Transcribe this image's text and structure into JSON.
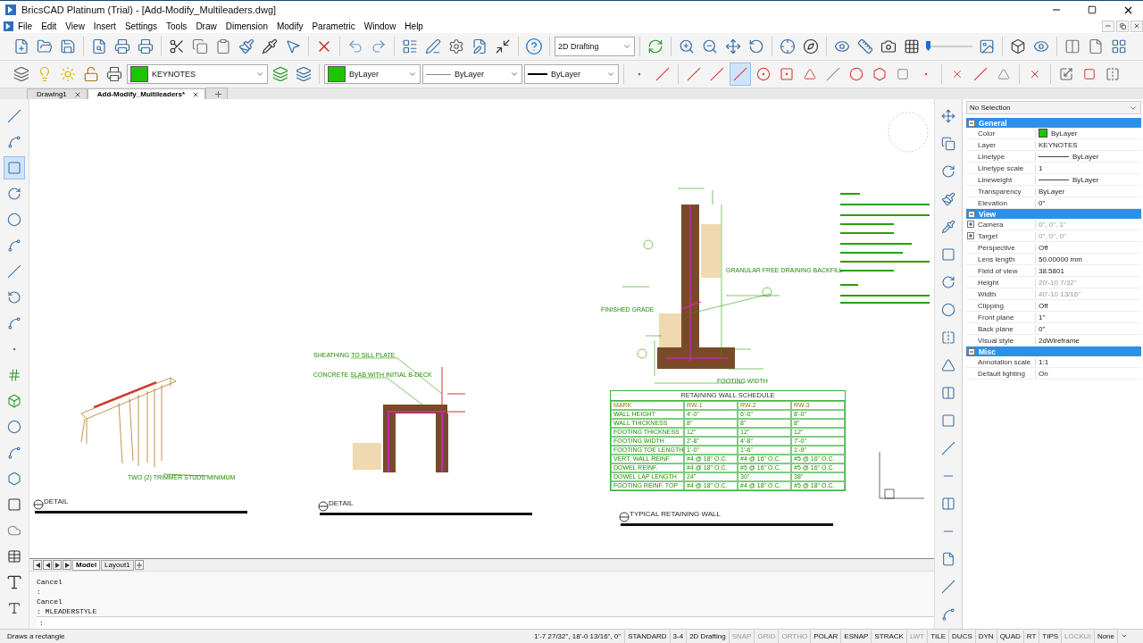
{
  "window": {
    "title": "BricsCAD Platinum (Trial) - [Add-Modify_Multileaders.dwg]"
  },
  "menu": [
    "File",
    "Edit",
    "View",
    "Insert",
    "Settings",
    "Tools",
    "Draw",
    "Dimension",
    "Modify",
    "Parametric",
    "Window",
    "Help"
  ],
  "workspace": {
    "value": "2D Drafting"
  },
  "layer_bar": {
    "layer": "KEYNOTES",
    "entity_color": "ByLayer",
    "linetype": "ByLayer",
    "lineweight": "ByLayer"
  },
  "document_tabs": [
    {
      "label": "Drawing1",
      "selected": false
    },
    {
      "label": "Add-Modify_Multileaders*",
      "selected": true
    }
  ],
  "drawing": {
    "details": [
      {
        "title": "DETAIL"
      },
      {
        "title": "DETAIL"
      },
      {
        "title": "TYPICAL RETAINING WALL"
      }
    ],
    "callouts": [
      {
        "text": "TWO (2) TRIMMER STUDS MINIMUM"
      },
      {
        "text": "SHEATHING TO SILL PLATE"
      },
      {
        "text": "CONCRETE SLAB WITH INITIAL B-DECK"
      },
      {
        "text": "GRANULAR FREE DRAINING BACKFILL"
      },
      {
        "text": "FINISHED GRADE"
      },
      {
        "text": "FOOTING WIDTH"
      }
    ],
    "schedule": {
      "title": "RETAINING WALL SCHEDULE",
      "columns": [
        "MARK",
        "RW-1",
        "RW-2",
        "RW-3"
      ],
      "rows": [
        [
          "WALL HEIGHT",
          "4'-0\"",
          "6'-0\"",
          "8'-0\""
        ],
        [
          "WALL THICKNESS",
          "8\"",
          "8\"",
          "8\""
        ],
        [
          "FOOTING THICKNESS",
          "12\"",
          "12\"",
          "12\""
        ],
        [
          "FOOTING WIDTH",
          "2'-8\"",
          "4'-8\"",
          "7'-0\""
        ],
        [
          "FOOTING TOE LENGTH",
          "1'-0\"",
          "1'-6\"",
          "1'-9\""
        ],
        [
          "VERT. WALL REINF.",
          "#4 @ 18\" O.C.",
          "#4 @ 16\" O.C.",
          "#5 @ 16\" O.C."
        ],
        [
          "DOWEL REINF.",
          "#4 @ 18\" O.C.",
          "#5 @ 16\" O.C.",
          "#5 @ 16\" O.C."
        ],
        [
          "DOWEL LAP LENGTH",
          "24\"",
          "30\"",
          "38\""
        ],
        [
          "FOOTING REINF. TOP",
          "#4 @ 18\" O.C.",
          "#4 @ 18\" O.C.",
          "#5 @ 18\" O.C."
        ]
      ]
    }
  },
  "properties": {
    "selection": "No Selection",
    "sections": [
      {
        "title": "General",
        "expanded": true,
        "rows": [
          {
            "label": "Color",
            "value": "ByLayer",
            "kind": "color"
          },
          {
            "label": "Layer",
            "value": "KEYNOTES",
            "kind": "text"
          },
          {
            "label": "Linetype",
            "value": "ByLayer",
            "kind": "line"
          },
          {
            "label": "Linetype scale",
            "value": "1",
            "kind": "text"
          },
          {
            "label": "Lineweight",
            "value": "ByLayer",
            "kind": "line"
          },
          {
            "label": "Transparency",
            "value": "ByLayer",
            "kind": "text"
          },
          {
            "label": "Elevation",
            "value": "0\"",
            "kind": "text"
          }
        ]
      },
      {
        "title": "View",
        "expanded": true,
        "rows": [
          {
            "label": "Camera",
            "value": "0\", 0\", 1\"",
            "kind": "group",
            "expanded": false,
            "disabled": true
          },
          {
            "label": "Target",
            "value": "0\", 0\", 0\"",
            "kind": "group",
            "expanded": false,
            "disabled": true
          },
          {
            "label": "Perspective",
            "value": "Off",
            "kind": "text"
          },
          {
            "label": "Lens length",
            "value": "50.00000 mm",
            "kind": "text"
          },
          {
            "label": "Field of view",
            "value": "38.5801",
            "kind": "text"
          },
          {
            "label": "Height",
            "value": "20'-10 7/32\"",
            "kind": "text",
            "disabled": true
          },
          {
            "label": "Width",
            "value": "40'-10 13/16\"",
            "kind": "text",
            "disabled": true
          },
          {
            "label": "Clipping",
            "value": "Off",
            "kind": "text"
          },
          {
            "label": "Front plane",
            "value": "1\"",
            "kind": "text"
          },
          {
            "label": "Back plane",
            "value": "0\"",
            "kind": "text"
          },
          {
            "label": "Visual style",
            "value": "2dWireframe",
            "kind": "text"
          }
        ]
      },
      {
        "title": "Misc",
        "expanded": true,
        "rows": [
          {
            "label": "Annotation scale",
            "value": "1:1",
            "kind": "text"
          },
          {
            "label": "Default lighting",
            "value": "On",
            "kind": "text"
          }
        ]
      }
    ]
  },
  "layout_tabs": [
    {
      "label": "Model",
      "selected": true
    },
    {
      "label": "Layout1",
      "selected": false
    }
  ],
  "command_history": [
    "Cancel",
    ":",
    "Cancel",
    ": MLEADERSTYLE"
  ],
  "command_prompt": ":",
  "status_bar": {
    "hint": "Draws a rectangle",
    "coordinates": "1'-7 27/32\", 18'-0 13/16\", 0\"",
    "fields": [
      "STANDARD",
      "3-4",
      "2D Drafting"
    ],
    "toggles": [
      {
        "label": "SNAP",
        "on": false
      },
      {
        "label": "GRID",
        "on": false
      },
      {
        "label": "ORTHO",
        "on": false
      },
      {
        "label": "POLAR",
        "on": true
      },
      {
        "label": "ESNAP",
        "on": true
      },
      {
        "label": "STRACK",
        "on": true
      },
      {
        "label": "LWT",
        "on": false
      },
      {
        "label": "TILE",
        "on": true
      },
      {
        "label": "DUCS",
        "on": true
      },
      {
        "label": "DYN",
        "on": true
      },
      {
        "label": "QUAD",
        "on": true
      },
      {
        "label": "RT",
        "on": true
      },
      {
        "label": "TIPS",
        "on": true
      },
      {
        "label": "LOCKUI",
        "on": false
      }
    ],
    "annotation": "None"
  }
}
